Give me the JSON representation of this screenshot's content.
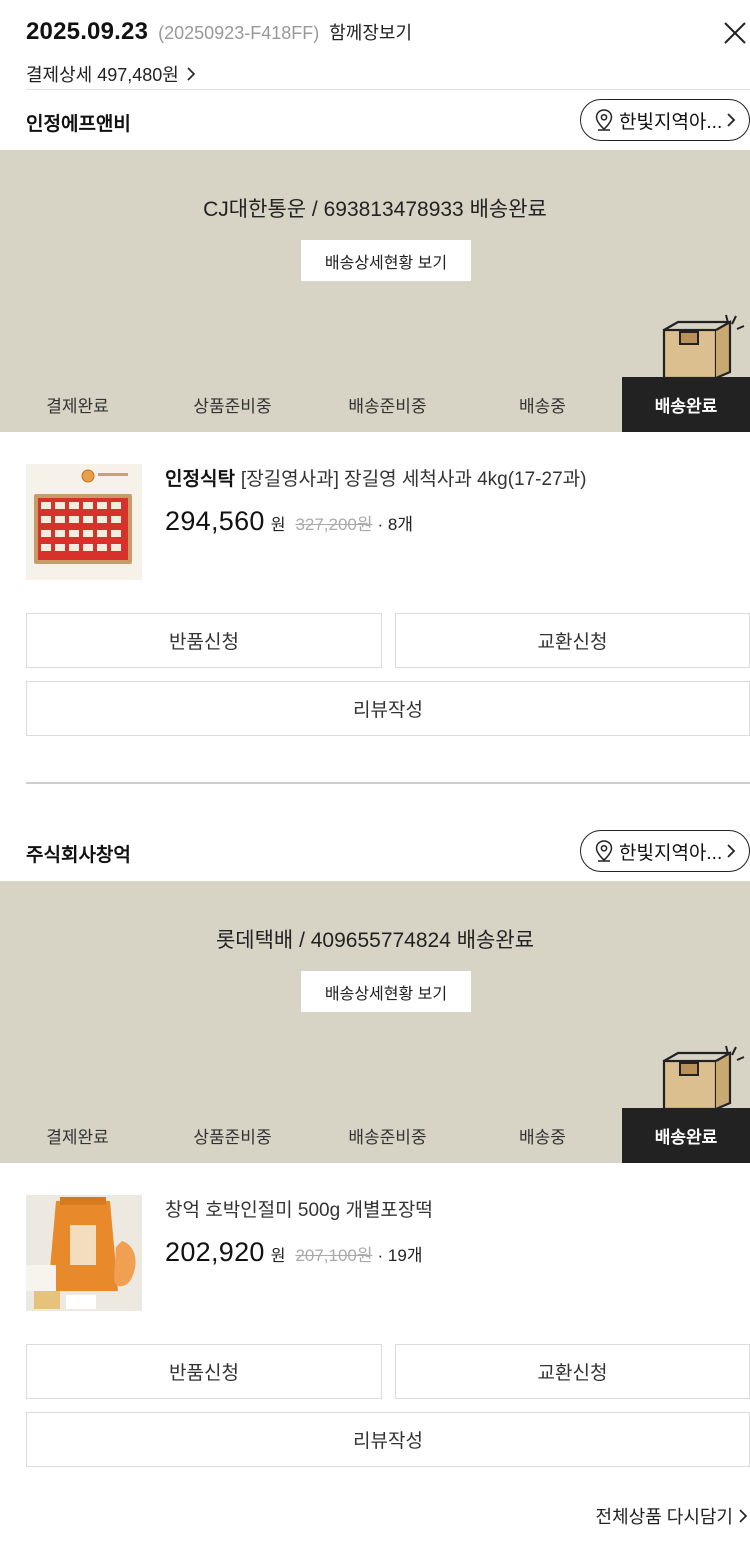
{
  "header": {
    "order_date": "2025.09.23",
    "order_id": "(20250923-F418FF)",
    "together_link": "함께장보기",
    "payment_detail": "결제상세 497,480원"
  },
  "steps": [
    "결제완료",
    "상품준비중",
    "배송준비중",
    "배송중",
    "배송완료"
  ],
  "sellers": [
    {
      "name": "인정에프앤비",
      "region": "한빛지역아...",
      "tracking": "CJ대한통운 / 693813478933 배송완료",
      "track_button": "배송상세현황 보기",
      "product": {
        "brand": "인정식탁",
        "title": "[장길영사과] 장길영 세척사과 4kg(17-27과)",
        "price": "294,560",
        "currency": "원",
        "original_price": "327,200원",
        "quantity": "· 8개"
      },
      "buttons": {
        "return": "반품신청",
        "exchange": "교환신청",
        "review": "리뷰작성"
      }
    },
    {
      "name": "주식회사창억",
      "region": "한빛지역아...",
      "tracking": "롯데택배 / 409655774824 배송완료",
      "track_button": "배송상세현황 보기",
      "product": {
        "brand": "",
        "title": "창억 호박인절미 500g 개별포장떡",
        "price": "202,920",
        "currency": "원",
        "original_price": "207,100원",
        "quantity": "· 19개"
      },
      "buttons": {
        "return": "반품신청",
        "exchange": "교환신청",
        "review": "리뷰작성"
      }
    }
  ],
  "footer": {
    "reorder_all": "전체상품 다시담기"
  },
  "colors": {
    "panel_bg": "#d7d4c6",
    "active_step_bg": "#222222",
    "box_color": "#dcbf8f"
  }
}
